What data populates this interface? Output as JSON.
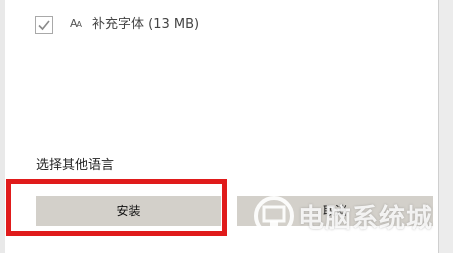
{
  "optional_features": {
    "supplemental_fonts": {
      "checked": true,
      "icon": "font-icon",
      "label": "补充字体 (13 MB)"
    }
  },
  "other_languages": {
    "label": "选择其他语言"
  },
  "buttons": {
    "install_label": "安装",
    "cancel_label": "取消"
  },
  "watermark": {
    "text": "电脑系统城",
    "icon": "computer-logo-icon"
  },
  "colors": {
    "highlight": "#e01b1b",
    "button_bg": "#d3d0ca"
  }
}
